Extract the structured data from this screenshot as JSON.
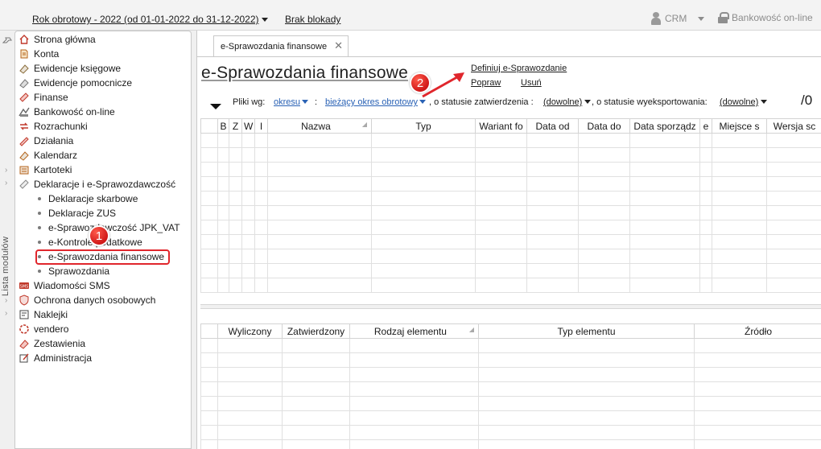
{
  "topbar": {
    "fiscal_year": "Rok obrotowy - 2022  (od 01-01-2022 do 31-12-2022)",
    "lock_status": "Brak blokady",
    "crm_label": "CRM",
    "banking_label": "Bankowość on-line"
  },
  "strip": {
    "label": "Lista modułów"
  },
  "sidebar": {
    "items": [
      {
        "label": "Strona główna",
        "icon": "home-icon"
      },
      {
        "label": "Konta",
        "icon": "accounts-icon"
      },
      {
        "label": "Ewidencje księgowe",
        "icon": "ledger-icon"
      },
      {
        "label": "Ewidencje pomocnicze",
        "icon": "auxiliary-ledger-icon"
      },
      {
        "label": "Finanse",
        "icon": "finance-icon"
      },
      {
        "label": "Bankowość on-line",
        "icon": "bank-icon"
      },
      {
        "label": "Rozrachunki",
        "icon": "settlements-icon"
      },
      {
        "label": "Działania",
        "icon": "actions-icon"
      },
      {
        "label": "Kalendarz",
        "icon": "calendar-icon"
      },
      {
        "label": "Kartoteki",
        "icon": "records-icon"
      },
      {
        "label": "Deklaracje i e-Sprawozdawczość",
        "icon": "declarations-icon"
      }
    ],
    "subitems": [
      {
        "label": "Deklaracje skarbowe"
      },
      {
        "label": "Deklaracje ZUS"
      },
      {
        "label": "e-Sprawozdawczość JPK_VAT"
      },
      {
        "label": "e-Kontrole podatkowe"
      },
      {
        "label": "e-Sprawozdania finansowe"
      },
      {
        "label": "Sprawozdania"
      }
    ],
    "items_after": [
      {
        "label": "Wiadomości SMS",
        "icon": "sms-icon"
      },
      {
        "label": "Ochrona danych osobowych",
        "icon": "data-protection-icon"
      },
      {
        "label": "Naklejki",
        "icon": "stickers-icon"
      },
      {
        "label": "vendero",
        "icon": "vendero-icon"
      },
      {
        "label": "Zestawienia",
        "icon": "reports-icon"
      },
      {
        "label": "Administracja",
        "icon": "admin-icon"
      }
    ]
  },
  "annotations": {
    "badge1": "1",
    "badge2": "2"
  },
  "colors": {
    "annotation_red": "#e0262c",
    "link_blue": "#2a62b5"
  },
  "main": {
    "tab_label": "e-Sprawozdania finansowe",
    "page_title": "e-Sprawozdania finansowe",
    "actions": {
      "define": "Definiuj e-Sprawozdanie",
      "edit": "Popraw",
      "delete": "Usuń"
    },
    "filter": {
      "prefix": "Pliki wg:",
      "period": "okresu",
      "sep1": ":",
      "period_value": "bieżący okres obrotowy",
      "approval_label": ", o statusie zatwierdzenia :",
      "approval_value": "(dowolne)",
      "export_label": ", o statusie wyeksportowania:",
      "export_value": "(dowolne)"
    },
    "record_count": "/0",
    "top_grid": {
      "columns": [
        "",
        "B",
        "Z",
        "W",
        "I",
        "Nazwa",
        "Typ",
        "Wariant fo",
        "Data od",
        "Data do",
        "Data sporządz",
        "e",
        "Miejsce s",
        "Wersja sc"
      ]
    },
    "bottom_grid": {
      "columns": [
        "",
        "Wyliczony",
        "Zatwierdzony",
        "Rodzaj elementu",
        "Typ elementu",
        "Źródło"
      ]
    }
  }
}
